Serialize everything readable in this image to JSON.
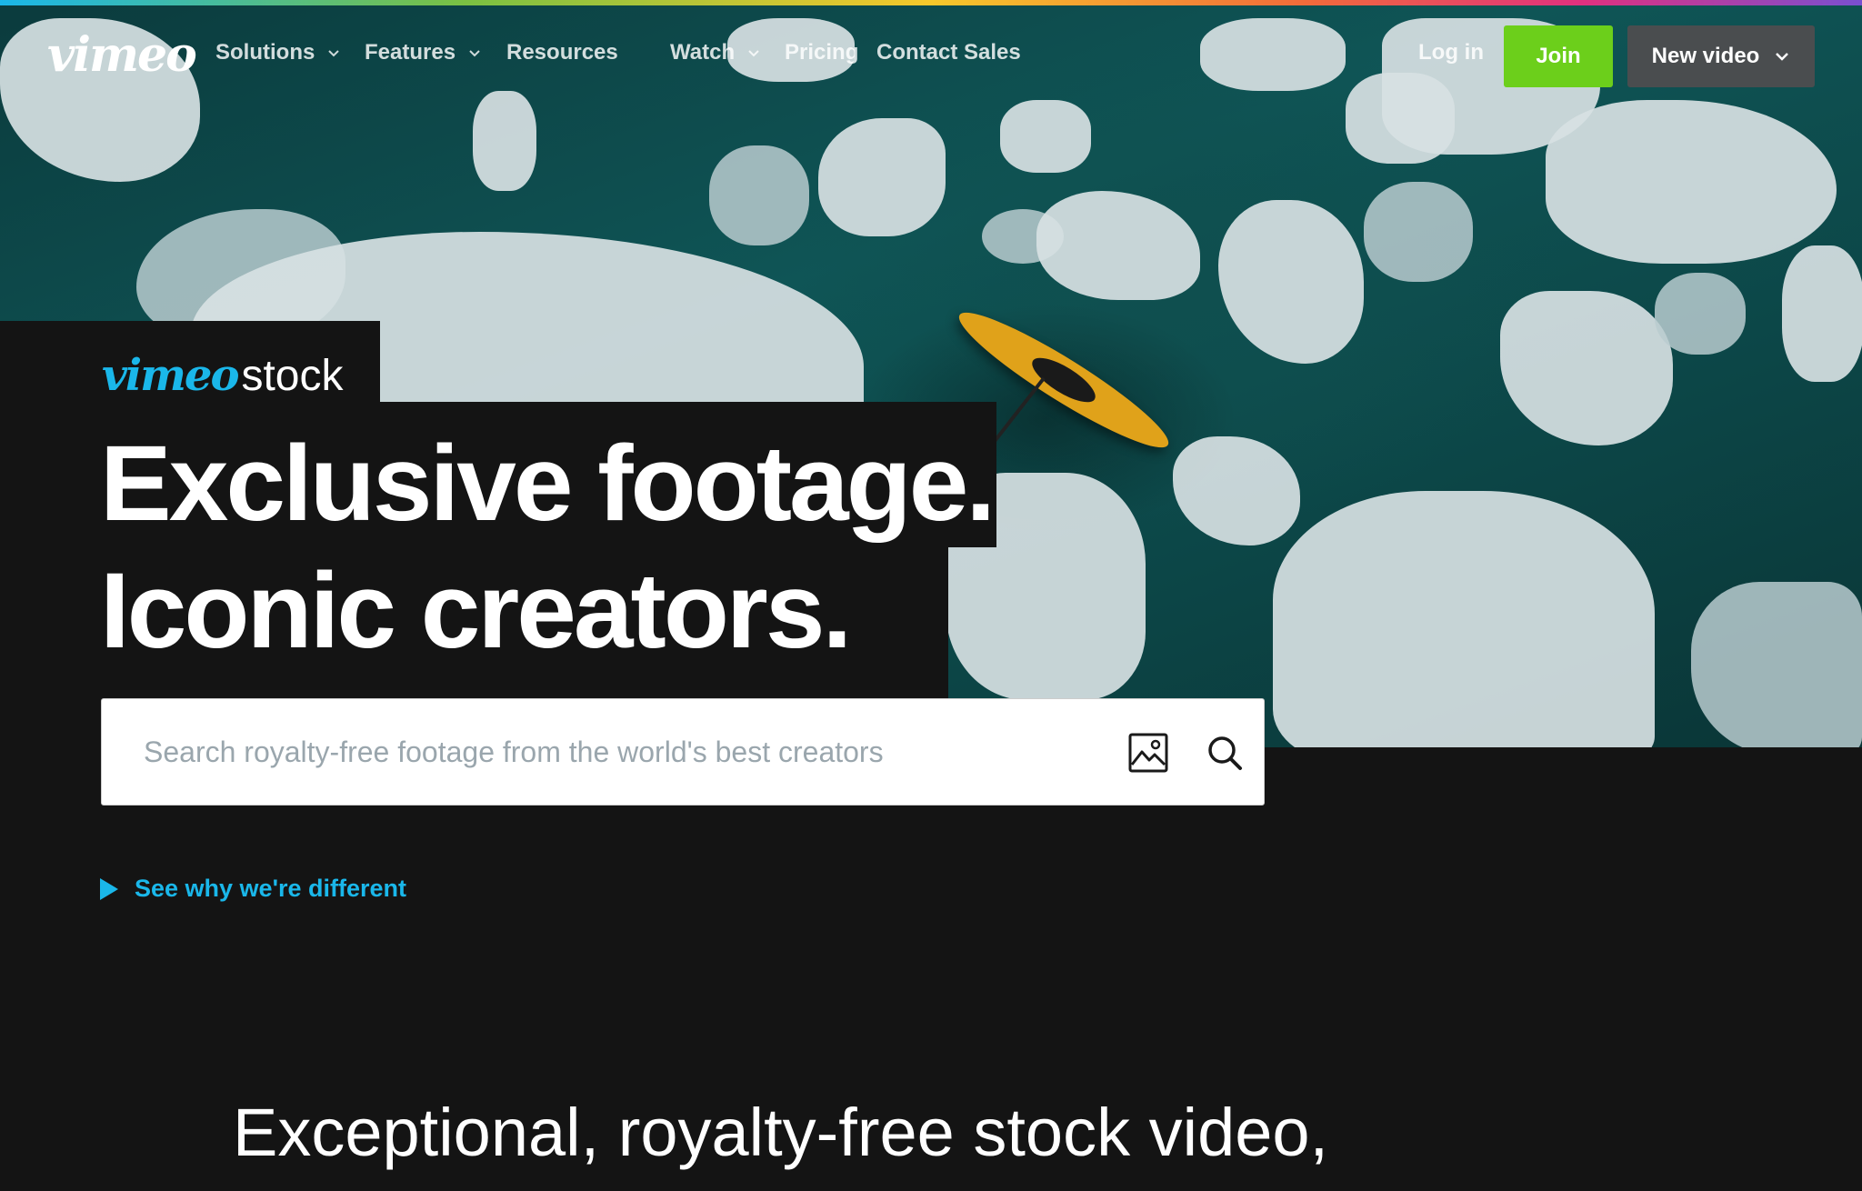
{
  "nav": {
    "logo": "vimeo",
    "items": [
      {
        "label": "Solutions",
        "dropdown": true
      },
      {
        "label": "Features",
        "dropdown": true
      },
      {
        "label": "Resources",
        "dropdown": false
      },
      {
        "label": "Watch",
        "dropdown": true
      },
      {
        "label": "Pricing",
        "dropdown": false
      },
      {
        "label": "Contact Sales",
        "dropdown": false
      }
    ],
    "login": "Log in",
    "join": "Join",
    "new_video": "New video"
  },
  "hero": {
    "brand_primary": "vimeo",
    "brand_secondary": "stock",
    "headline_line1": "Exclusive footage.",
    "headline_line2": "Iconic creators."
  },
  "search": {
    "placeholder": "Search royalty-free footage from the world's best creators",
    "value": "",
    "image_search_icon": "image-icon",
    "search_icon": "search-icon"
  },
  "cta": {
    "why_label": "See why we're different",
    "icon": "play-triangle-icon"
  },
  "tagline": "Exceptional, royalty-free stock video,",
  "colors": {
    "accent": "#1ab7ea",
    "join": "#6ccf1b",
    "new_video_bg": "#4a4d4f",
    "page_bg": "#141414"
  }
}
